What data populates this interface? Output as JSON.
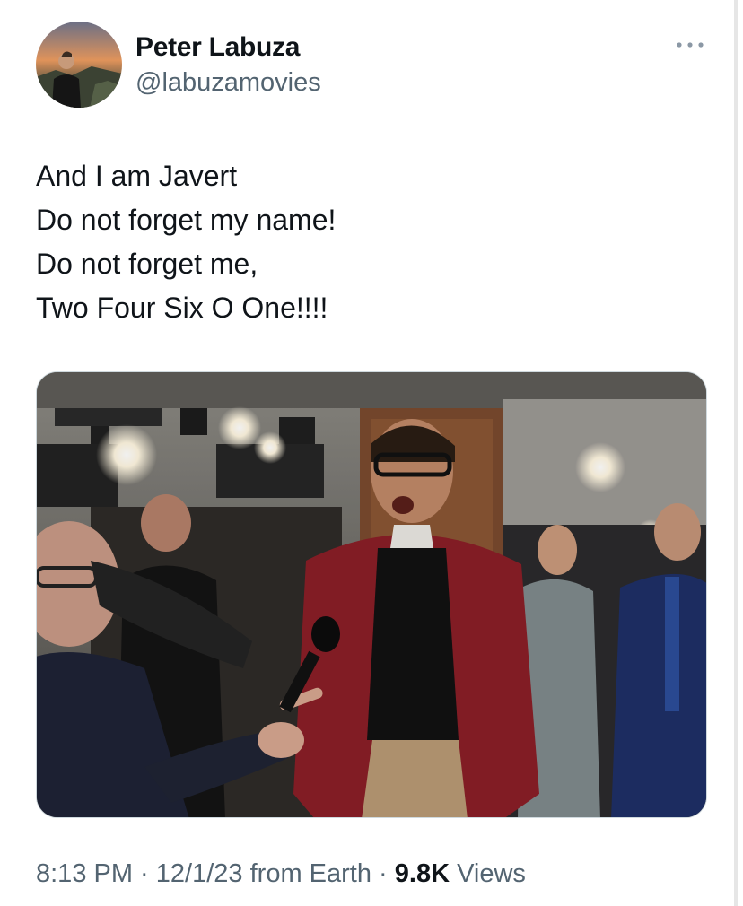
{
  "author": {
    "display_name": "Peter Labuza",
    "handle": "@labuzamovies"
  },
  "tweet": {
    "lines": [
      "And I am Javert",
      "Do not forget my name!",
      "Do not forget me,",
      "Two Four Six O One!!!!"
    ]
  },
  "meta": {
    "time": "8:13 PM",
    "sep1": " · ",
    "date": "12/1/23",
    "source": " from Earth",
    "sep2": " · ",
    "views_count": "9.8K",
    "views_label": " Views"
  },
  "icons": {
    "more": "more-dots-icon"
  },
  "colors": {
    "text_primary": "#0f1419",
    "text_secondary": "#536471",
    "border": "#cfd9de"
  }
}
